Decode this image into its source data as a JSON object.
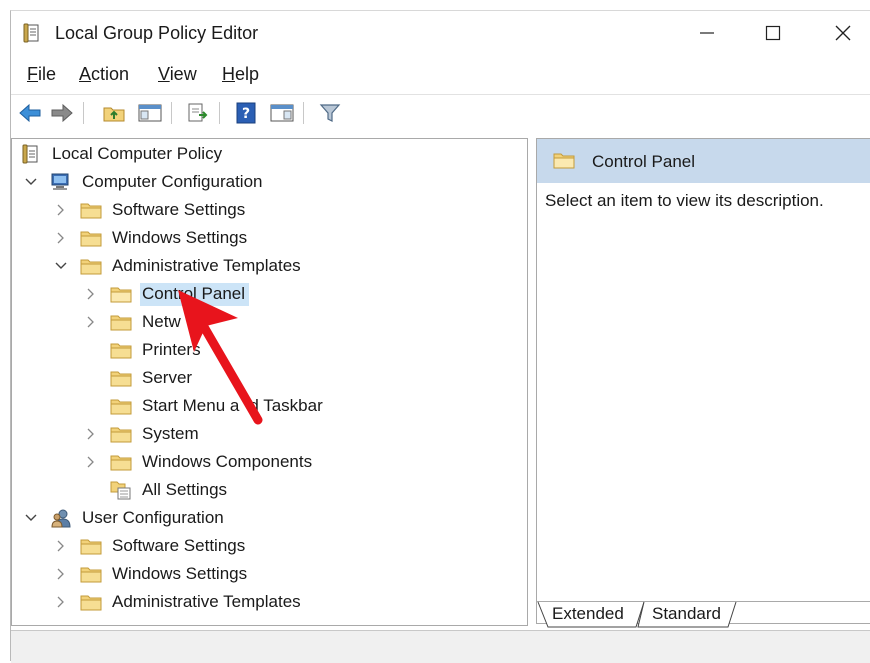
{
  "window": {
    "title": "Local Group Policy Editor"
  },
  "menu": {
    "file": "ile",
    "file_key": "F",
    "action": "ction",
    "action_key": "A",
    "view": "iew",
    "view_key": "V",
    "help": "elp",
    "help_key": "H"
  },
  "tree": {
    "root": "Local Computer Policy",
    "computer": "Computer Configuration",
    "c_software": "Software Settings",
    "c_windows": "Windows Settings",
    "c_admin": "Administrative Templates",
    "control_panel": "Control Panel",
    "network": "Netw",
    "printers": "Printers",
    "server": "Server",
    "start_menu_a": "Start Menu a",
    "start_menu_b": "d Taskbar",
    "system": "System",
    "windows_components": "Windows Components",
    "all_settings": "All Settings",
    "user": "User Configuration",
    "u_software": "Software Settings",
    "u_windows": "Windows Settings",
    "u_admin": "Administrative Templates"
  },
  "right_pane": {
    "title": "Control Panel",
    "description": "Select an item to view its description."
  },
  "tabs": {
    "extended": "Extended",
    "standard": "Standard"
  },
  "colors": {
    "selection": "#cce4f7",
    "header": "#c7d9ec",
    "arrow": "#e8141c",
    "folder": "#f2d27a"
  }
}
